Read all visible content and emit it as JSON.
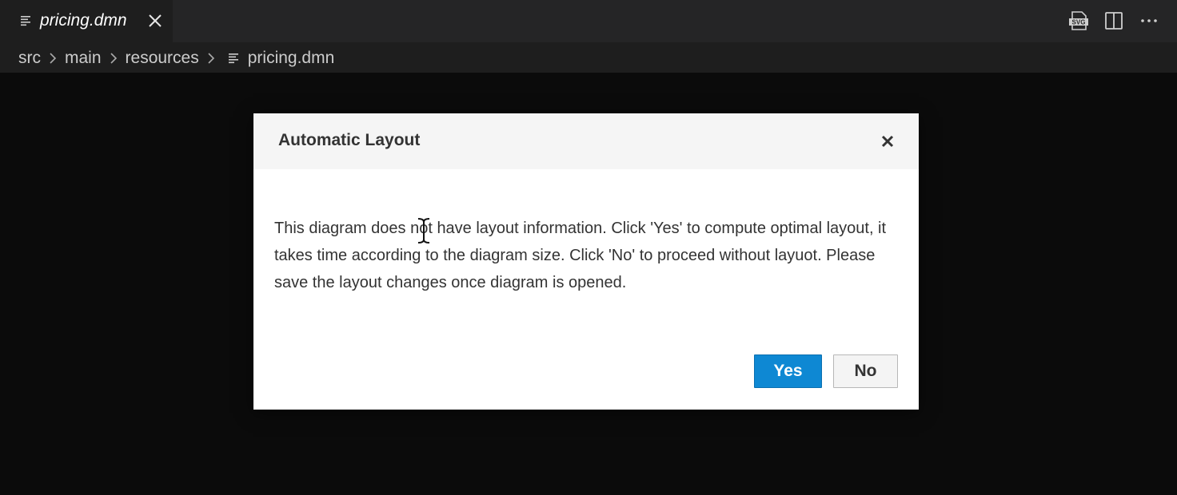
{
  "tab": {
    "label": "pricing.dmn",
    "close_icon": "close-icon",
    "file_icon": "file-lines-icon"
  },
  "toolbar": {
    "svg_label": "SVG",
    "actions": [
      "export-svg-icon",
      "split-editor-icon",
      "more-actions-icon"
    ]
  },
  "breadcrumb": {
    "items": [
      "src",
      "main",
      "resources",
      "pricing.dmn"
    ]
  },
  "dialog": {
    "title": "Automatic Layout",
    "message": "This diagram does not have layout information. Click 'Yes' to compute optimal layout, it takes time according to the diagram size. Click 'No' to proceed without layuot. Please save the layout changes once diagram is opened.",
    "yes_label": "Yes",
    "no_label": "No"
  },
  "colors": {
    "primary_button": "#0e88d3",
    "background": "#0b0b0b"
  }
}
